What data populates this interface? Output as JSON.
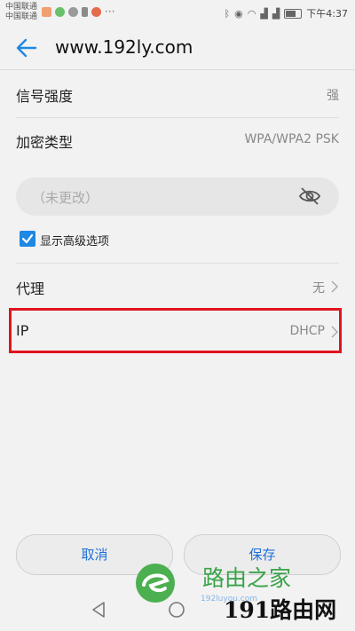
{
  "status_bar": {
    "carrier_1": "中国联通",
    "carrier_2": "中国联通",
    "more": "···",
    "time": "下午4:37"
  },
  "app_bar": {
    "title": "www.192ly.com"
  },
  "rows": {
    "signal": {
      "label": "信号强度",
      "value": "强"
    },
    "security": {
      "label": "加密类型",
      "value": "WPA/WPA2 PSK"
    },
    "proxy": {
      "label": "代理",
      "value": "无"
    },
    "ip": {
      "label": "IP",
      "value": "DHCP"
    }
  },
  "password": {
    "placeholder": "（未更改）"
  },
  "advanced_option": {
    "label": "显示高级选项",
    "checked": true
  },
  "buttons": {
    "cancel": "取消",
    "save": "保存"
  },
  "watermark": {
    "text_1": "路由之家",
    "text_2": "192luyou.com",
    "text_3": "191路由网"
  },
  "colors": {
    "accent": "#1e88e5",
    "highlight": "#e0141e"
  },
  "icons": [
    "back-arrow-icon",
    "eye-off-icon",
    "chevron-right-icon",
    "checkbox-checked-icon"
  ]
}
